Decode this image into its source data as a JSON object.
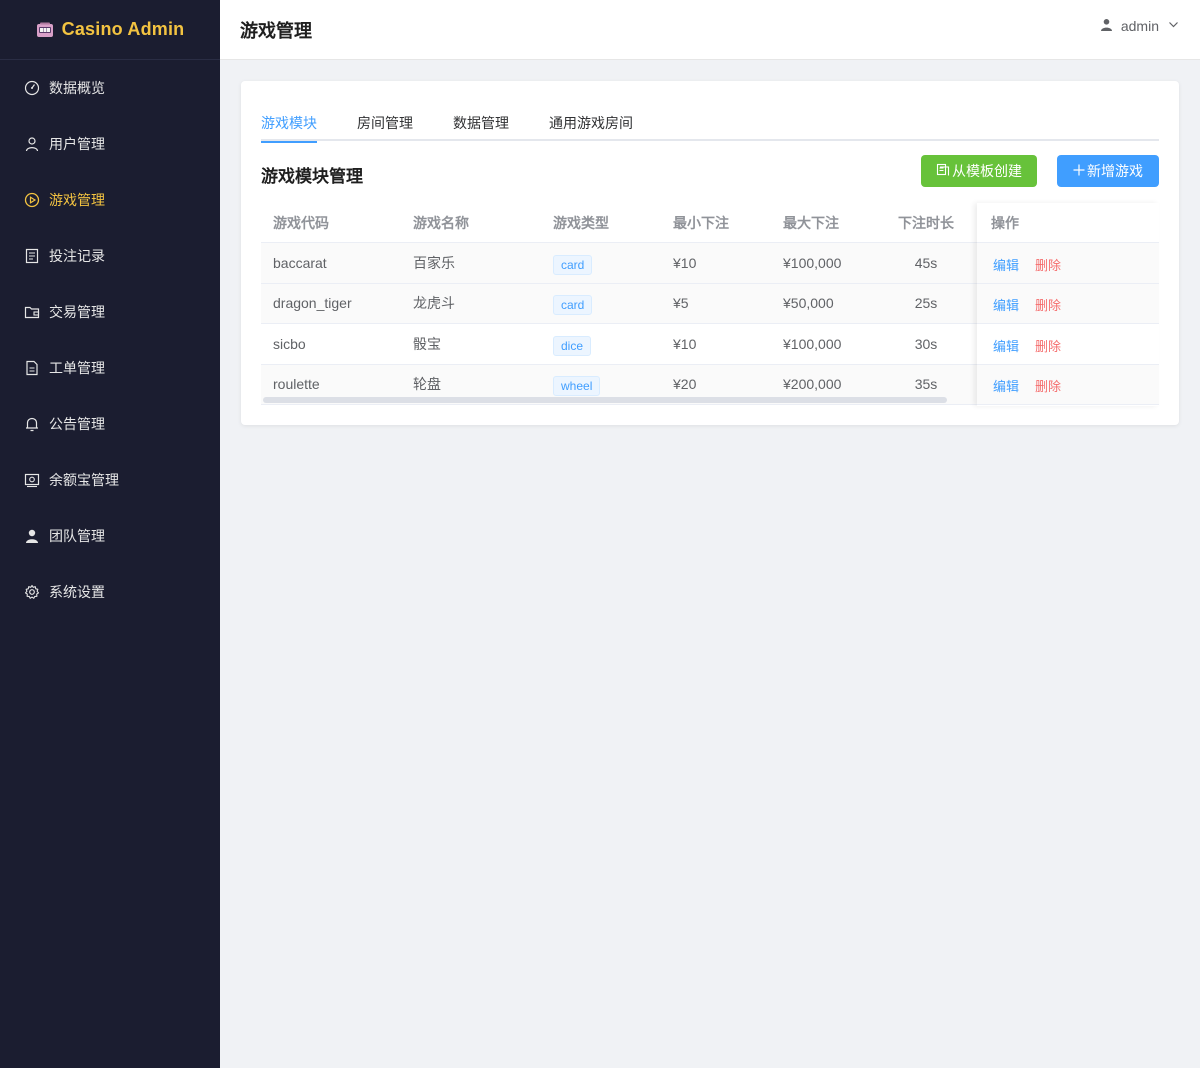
{
  "brand": {
    "title": "Casino Admin",
    "icon": "slot-machine-icon"
  },
  "sidebar": {
    "items": [
      {
        "label": "数据概览",
        "icon": "dashboard-icon",
        "active": false
      },
      {
        "label": "用户管理",
        "icon": "user-icon",
        "active": false
      },
      {
        "label": "游戏管理",
        "icon": "play-icon",
        "active": true
      },
      {
        "label": "投注记录",
        "icon": "document-icon",
        "active": false
      },
      {
        "label": "交易管理",
        "icon": "wallet-icon",
        "active": false
      },
      {
        "label": "工单管理",
        "icon": "ticket-icon",
        "active": false
      },
      {
        "label": "公告管理",
        "icon": "bell-icon",
        "active": false
      },
      {
        "label": "余额宝管理",
        "icon": "money-icon",
        "active": false
      },
      {
        "label": "团队管理",
        "icon": "team-icon",
        "active": false
      },
      {
        "label": "系统设置",
        "icon": "gear-icon",
        "active": false
      }
    ]
  },
  "header": {
    "title": "游戏管理",
    "user": "admin"
  },
  "tabs": [
    {
      "label": "游戏模块",
      "active": true
    },
    {
      "label": "房间管理",
      "active": false
    },
    {
      "label": "数据管理",
      "active": false
    },
    {
      "label": "通用游戏房间",
      "active": false
    }
  ],
  "section": {
    "title": "游戏模块管理",
    "template_button": "从模板创建",
    "add_button": "新增游戏"
  },
  "table": {
    "columns": [
      "游戏代码",
      "游戏名称",
      "游戏类型",
      "最小下注",
      "最大下注",
      "下注时长",
      "操作"
    ],
    "rows": [
      {
        "code": "baccarat",
        "name": "百家乐",
        "type": "card",
        "min": "¥10",
        "max": "¥100,000",
        "duration": "45s"
      },
      {
        "code": "dragon_tiger",
        "name": "龙虎斗",
        "type": "card",
        "min": "¥5",
        "max": "¥50,000",
        "duration": "25s"
      },
      {
        "code": "sicbo",
        "name": "骰宝",
        "type": "dice",
        "min": "¥10",
        "max": "¥100,000",
        "duration": "30s"
      },
      {
        "code": "roulette",
        "name": "轮盘",
        "type": "wheel",
        "min": "¥20",
        "max": "¥200,000",
        "duration": "35s"
      }
    ],
    "edit_label": "编辑",
    "delete_label": "删除"
  },
  "colors": {
    "sidebar_bg": "#1b1d30",
    "accent_gold": "#f3c341",
    "primary": "#409eff",
    "success": "#67c23a",
    "danger": "#f56c6c"
  }
}
